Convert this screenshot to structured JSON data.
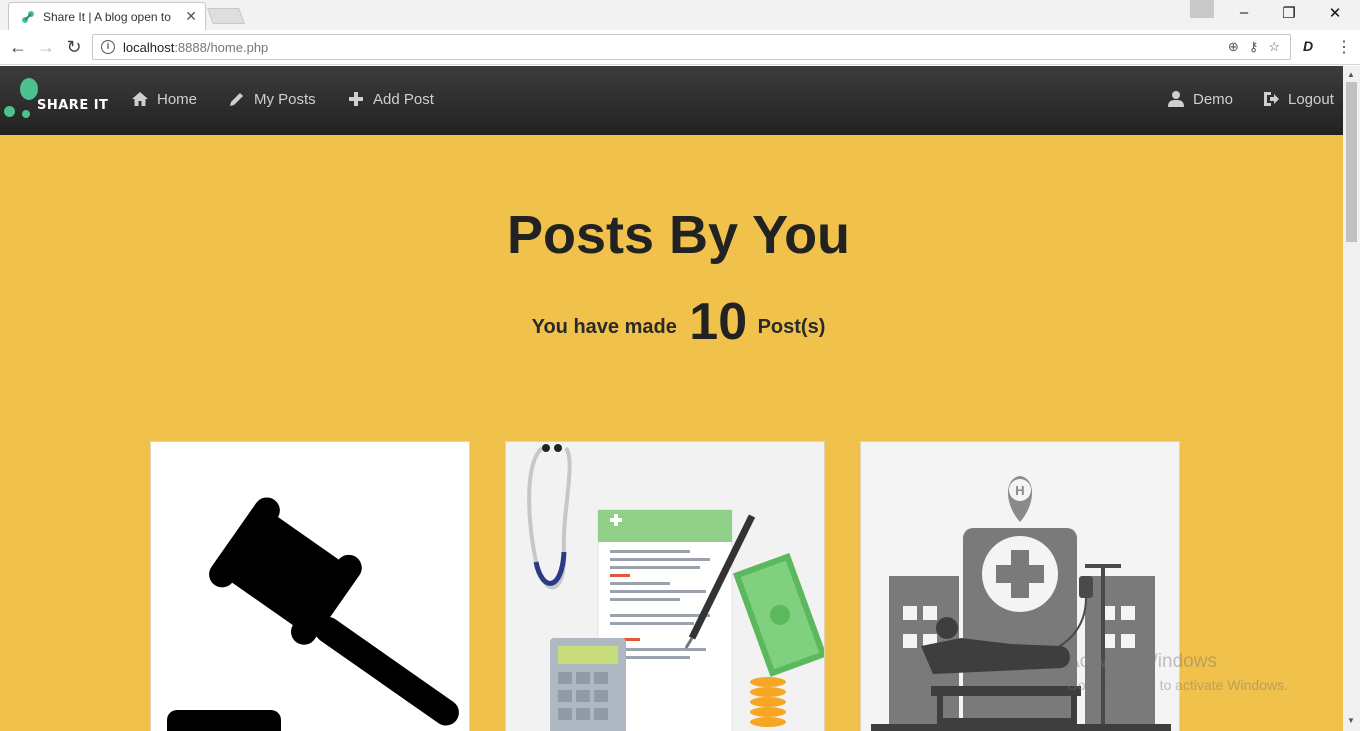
{
  "browser": {
    "tab_title": "Share It | A blog open to",
    "url_host": "localhost",
    "url_path": ":8888/home.php"
  },
  "navbar": {
    "brand": "SHARE IT",
    "items": [
      {
        "label": "Home",
        "icon": "home-icon"
      },
      {
        "label": "My Posts",
        "icon": "pencil-icon"
      },
      {
        "label": "Add Post",
        "icon": "plus-icon"
      }
    ],
    "right_items": [
      {
        "label": "Demo",
        "icon": "user-icon"
      },
      {
        "label": "Logout",
        "icon": "logout-icon"
      }
    ]
  },
  "hero": {
    "title": "Posts By You",
    "sub_prefix": "You have made",
    "post_count": "10",
    "sub_suffix": "Post(s)"
  },
  "cards": [
    {
      "image": "gavel-image"
    },
    {
      "image": "insurance-claim-image"
    },
    {
      "image": "hospital-image"
    }
  ],
  "watermark": {
    "line1": "Activate Windows",
    "line2": "Go to Settings to activate Windows."
  },
  "colors": {
    "page_bg": "#f0c14b",
    "navbar_bg": "#2a2a2a",
    "brand_accent": "#4ec28e"
  }
}
